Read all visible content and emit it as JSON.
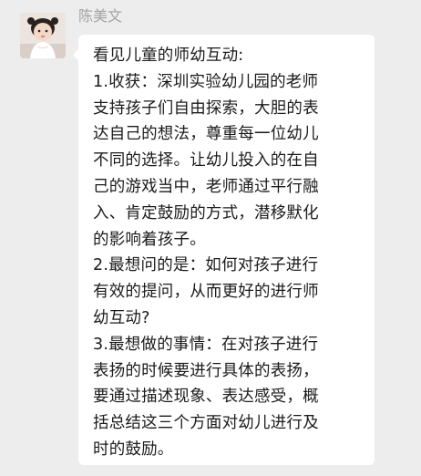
{
  "sender": {
    "name": "陈美文",
    "avatar_icon": "baby-photo-avatar"
  },
  "message": {
    "lines": [
      "看见儿童的师幼互动:",
      "1.收获：深圳实验幼儿园的老师",
      "支持孩子们自由探索，大胆的表",
      "达自己的想法，尊重每一位幼儿",
      "不同的选择。让幼儿投入的在自",
      "己的游戏当中，老师通过平行融",
      "入、肯定鼓励的方式，潜移默化",
      "的影响着孩子。",
      "2.最想问的是：如何对孩子进行",
      "有效的提问，从而更好的进行师",
      "幼互动?",
      "3.最想做的事情：在对孩子进行",
      "表扬的时候要进行具体的表扬，",
      "要通过描述现象、表达感受，概",
      "括总结这三个方面对幼儿进行及",
      "时的鼓励。"
    ]
  },
  "colors": {
    "background": "#ededed",
    "bubble": "#ffffff",
    "name_text": "#a3a3a3",
    "message_text": "#1b1b1b"
  }
}
